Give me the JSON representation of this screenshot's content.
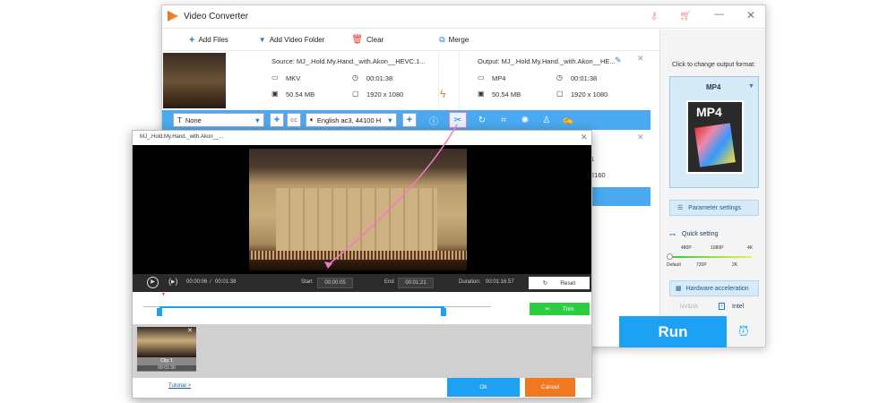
{
  "app": {
    "title": "Video Converter"
  },
  "toolbar": {
    "add_files": "Add Files",
    "add_folder": "Add Video Folder",
    "clear": "Clear",
    "merge": "Merge"
  },
  "file": {
    "source": "Source: MJ_.Hold.My.Hand._with.Akon__HEVC.1...",
    "output": "Output: MJ_.Hold.My.Hand._with.Akon__HE...",
    "src_format": "MKV",
    "src_duration": "00:01:38",
    "src_size": "50.54 MB",
    "src_res": "1920 x 1080",
    "out_format": "MP4",
    "out_duration": "00:01:38",
    "out_size": "50.54 MB",
    "out_res": "1920 x 1080",
    "hidden_dur_frag": "1",
    "hidden_res_frag": "2160"
  },
  "edit_bar": {
    "subtitle": "None",
    "audio": "English ac3, 44100 H"
  },
  "right_panel": {
    "hint": "Click to change output format:",
    "format": "MP4",
    "format_icon_label": "MP4",
    "param": "Parameter settings",
    "quick": "Quick setting",
    "q_top": [
      "480P",
      "1080P",
      "4K"
    ],
    "q_bottom": [
      "Default",
      "720P",
      "2K"
    ],
    "hw": "Hardware acceleration",
    "nvidia": "NVIDIA",
    "intel": "Intel"
  },
  "run": {
    "label": "Run"
  },
  "dialog": {
    "title": "MJ_.Hold.My.Hand._with.Akon__...",
    "current_time": "00:00:06",
    "sep": "/",
    "total_time": "00:01:38",
    "start_label": "Start",
    "start_value": "00:00:05",
    "end_label": "End",
    "end_value": "00:01:21",
    "duration_label": "Duration:",
    "duration_value": "00:01:16.57",
    "reset": "Reset",
    "trim": "Trim",
    "clip_name": "Clip 1",
    "clip_time": "00:01:30",
    "tutorial": "Tutorial >",
    "ok": "Ok",
    "cancel": "Cancel"
  },
  "colors": {
    "accent": "#1da1f2",
    "trim": "#2ecc40",
    "cancel": "#f07820",
    "link_arrow": "#f07ac8"
  }
}
